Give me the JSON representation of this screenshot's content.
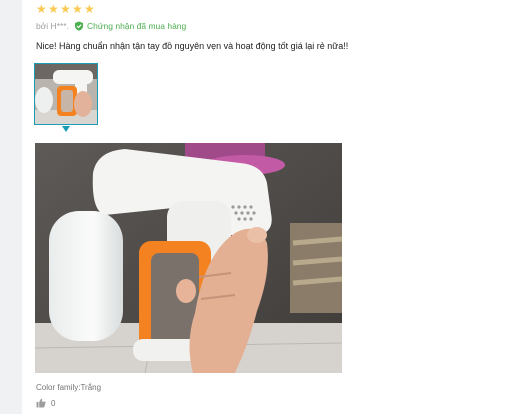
{
  "review": {
    "rating": 5,
    "author": "bởi H***.",
    "verified_label": "Chứng nhận đã mua hàng",
    "text": "Nice! Hàng chuẩn nhận tận tay đồ nguyên vẹn và hoạt động tốt giá lại rẻ nữa!!",
    "color_family": "Color family:Trắng",
    "likes": "0"
  },
  "colors": {
    "star": "#faca51",
    "verified": "#4caf50",
    "accent": "#1a9cb7",
    "product_orange": "#f58220"
  },
  "icons": {
    "star": "star-icon",
    "verified": "shield-check-icon",
    "like": "thumbs-up-icon"
  }
}
